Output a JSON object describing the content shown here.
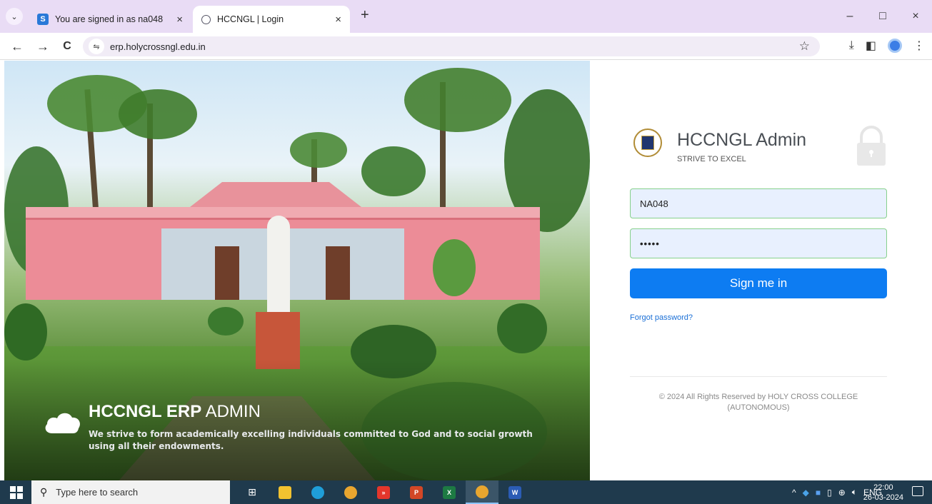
{
  "browser": {
    "tabs": [
      {
        "title": "You are signed in as na048",
        "icon": "s-icon",
        "close": "×"
      },
      {
        "title": "HCCNGL | Login",
        "icon": "globe-icon",
        "close": "×"
      }
    ],
    "new_tab": "+",
    "url": "erp.holycrossngl.edu.in",
    "nav": {
      "back": "←",
      "forward": "→",
      "reload": "C"
    },
    "window": {
      "minimize": "–",
      "maximize": "□",
      "close": "×"
    }
  },
  "hero": {
    "title_bold": "HCCNGL ERP",
    "title_light": " ADMIN",
    "subtitle": "We strive to form academically excelling individuals committed to God and to social growth using all their endowments."
  },
  "login": {
    "brand_title": "HCCNGL Admin",
    "brand_tagline": "STRIVE TO EXCEL",
    "username_value": "NA048",
    "password_value": "•••••",
    "signin_label": "Sign me in",
    "forgot_label": "Forgot password?",
    "copyright": "© 2024 All Rights Reserved by HOLY CROSS COLLEGE (AUTONOMOUS)"
  },
  "taskbar": {
    "search_placeholder": "Type here to search",
    "language": "ENG",
    "time": "22:00",
    "date": "26-03-2024"
  }
}
